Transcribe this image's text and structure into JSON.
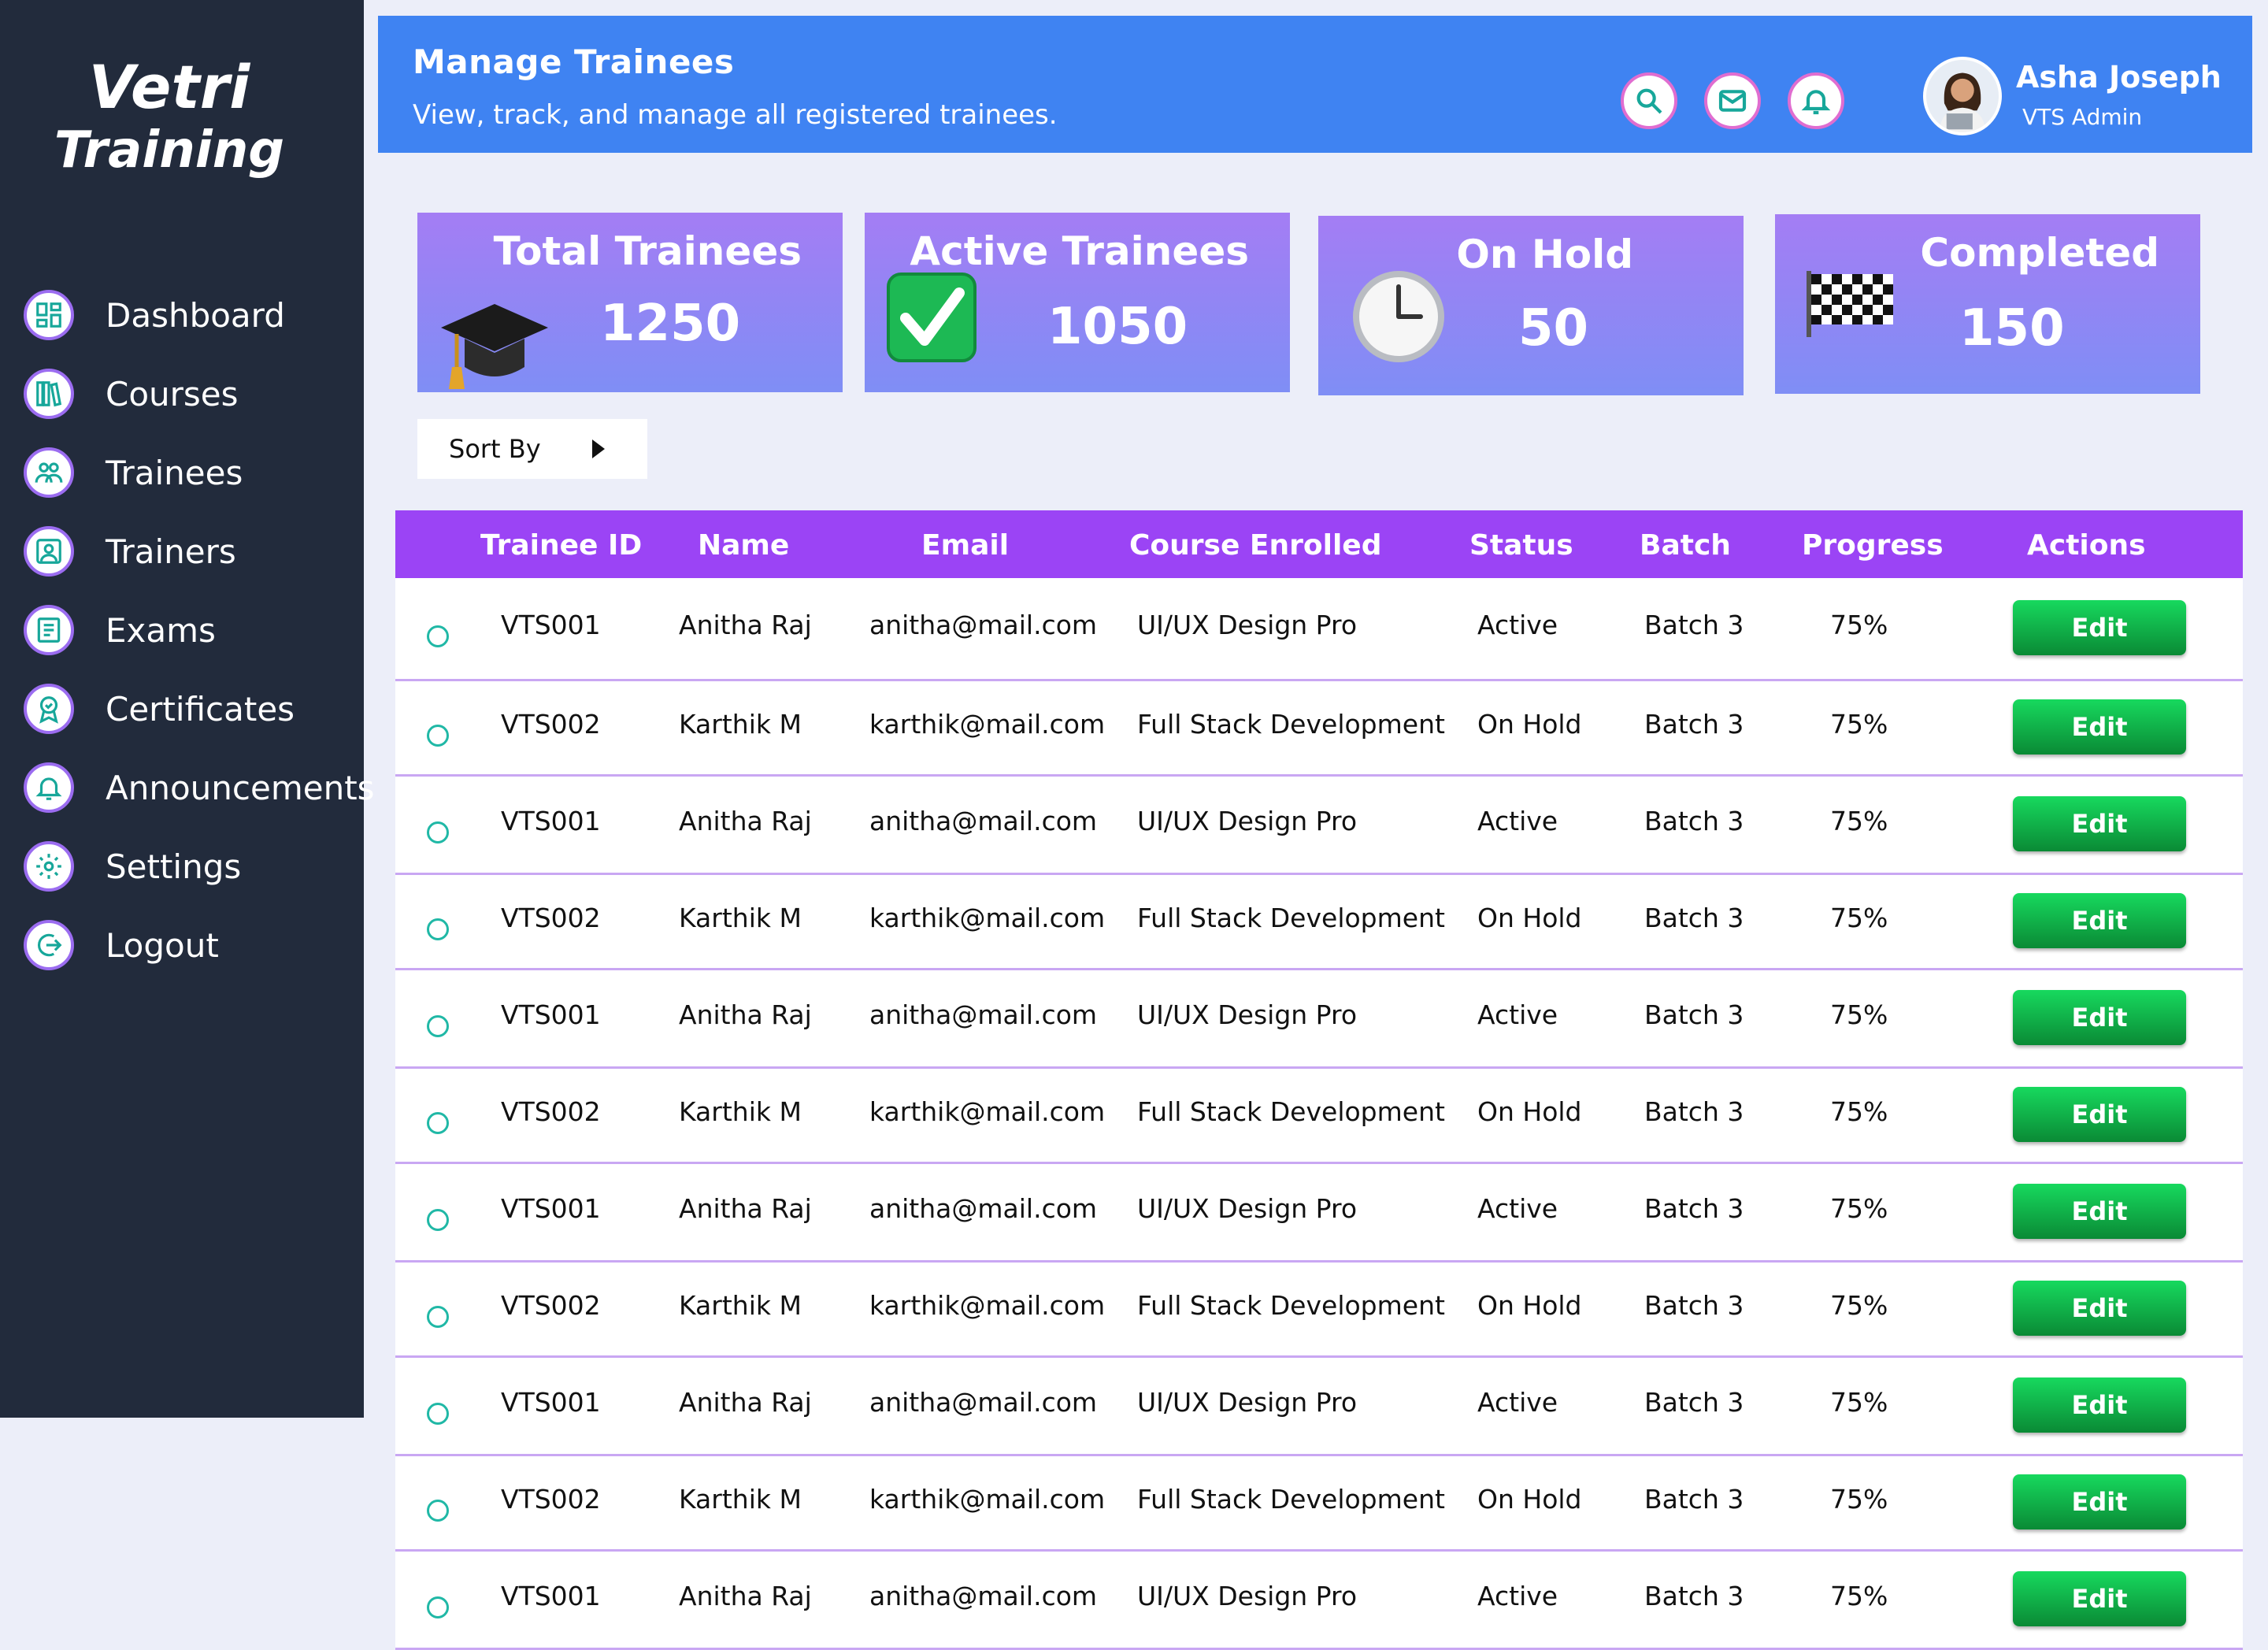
{
  "brand": {
    "line1": "Vetri",
    "line2": "Training"
  },
  "sidebar": {
    "items": [
      {
        "label": "Dashboard",
        "icon": "dashboard-icon"
      },
      {
        "label": "Courses",
        "icon": "courses-icon"
      },
      {
        "label": "Trainees",
        "icon": "trainees-icon"
      },
      {
        "label": "Trainers",
        "icon": "trainers-icon"
      },
      {
        "label": "Exams",
        "icon": "exams-icon"
      },
      {
        "label": "Certificates",
        "icon": "certificate-icon"
      },
      {
        "label": "Announcements",
        "icon": "bell-icon"
      },
      {
        "label": "Settings",
        "icon": "gear-icon"
      },
      {
        "label": "Logout",
        "icon": "logout-icon"
      }
    ]
  },
  "header": {
    "title": "Manage Trainees",
    "subtitle": "View, track, and manage all registered trainees.",
    "user_name": "Asha Joseph",
    "user_role": "VTS Admin"
  },
  "stats": [
    {
      "title": "Total Trainees",
      "value": "1250",
      "icon": "graduation-cap-icon"
    },
    {
      "title": "Active Trainees",
      "value": "1050",
      "icon": "check-mark-icon"
    },
    {
      "title": "On Hold",
      "value": "50",
      "icon": "clock-icon"
    },
    {
      "title": "Completed",
      "value": "150",
      "icon": "checkered-flag-icon"
    }
  ],
  "sort_label": "Sort By",
  "table": {
    "headers": [
      "Trainee ID",
      "Name",
      "Email",
      "Course Enrolled",
      "Status",
      "Batch",
      "Progress",
      "Actions"
    ],
    "edit_label": "Edit",
    "rows": [
      [
        "VTS001",
        "Anitha Raj",
        "anitha@mail.com",
        "UI/UX Design Pro",
        "Active",
        "Batch 3",
        "75%"
      ],
      [
        "VTS002",
        "Karthik M",
        "karthik@mail.com",
        "Full Stack Development",
        "On Hold",
        "Batch 3",
        "75%"
      ],
      [
        "VTS001",
        "Anitha Raj",
        "anitha@mail.com",
        "UI/UX Design Pro",
        "Active",
        "Batch 3",
        "75%"
      ],
      [
        "VTS002",
        "Karthik M",
        "karthik@mail.com",
        "Full Stack Development",
        "On Hold",
        "Batch 3",
        "75%"
      ],
      [
        "VTS001",
        "Anitha Raj",
        "anitha@mail.com",
        "UI/UX Design Pro",
        "Active",
        "Batch 3",
        "75%"
      ],
      [
        "VTS002",
        "Karthik M",
        "karthik@mail.com",
        "Full Stack Development",
        "On Hold",
        "Batch 3",
        "75%"
      ],
      [
        "VTS001",
        "Anitha Raj",
        "anitha@mail.com",
        "UI/UX Design Pro",
        "Active",
        "Batch 3",
        "75%"
      ],
      [
        "VTS002",
        "Karthik M",
        "karthik@mail.com",
        "Full Stack Development",
        "On Hold",
        "Batch 3",
        "75%"
      ],
      [
        "VTS001",
        "Anitha Raj",
        "anitha@mail.com",
        "UI/UX Design Pro",
        "Active",
        "Batch 3",
        "75%"
      ],
      [
        "VTS002",
        "Karthik M",
        "karthik@mail.com",
        "Full Stack Development",
        "On Hold",
        "Batch 3",
        "75%"
      ],
      [
        "VTS001",
        "Anitha Raj",
        "anitha@mail.com",
        "UI/UX Design Pro",
        "Active",
        "Batch 3",
        "75%"
      ]
    ]
  },
  "colors": {
    "sidebar_bg": "#222b3c",
    "header_bg": "#3f83f2",
    "table_header": "#9b44f5",
    "edit_button": "#0fb94a"
  }
}
